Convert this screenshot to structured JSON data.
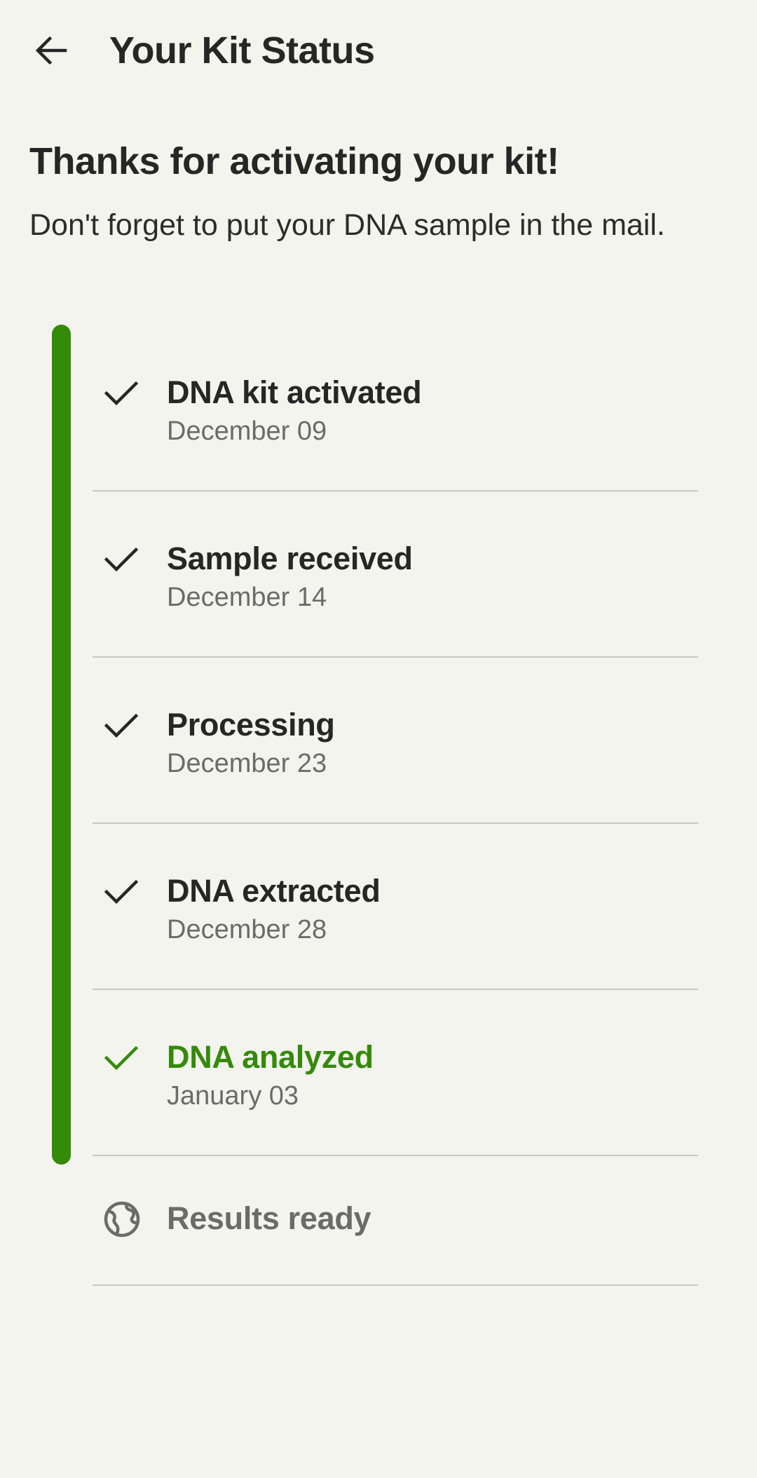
{
  "colors": {
    "background": "#f4f4ee",
    "accent_green": "#348a09",
    "text_primary": "#262626",
    "text_secondary": "#6b6b6b",
    "divider": "#c8c8c3"
  },
  "header": {
    "back_icon": "arrow-left-icon",
    "title": "Your Kit Status"
  },
  "main": {
    "heading": "Thanks for activating your kit!",
    "subtitle": "Don't forget to put your DNA sample in the mail."
  },
  "steps": [
    {
      "title": "DNA kit activated",
      "date": "December 09",
      "status": "complete",
      "icon": "check-icon"
    },
    {
      "title": "Sample received",
      "date": "December 14",
      "status": "complete",
      "icon": "check-icon"
    },
    {
      "title": "Processing",
      "date": "December 23",
      "status": "complete",
      "icon": "check-icon"
    },
    {
      "title": "DNA extracted",
      "date": "December 28",
      "status": "complete",
      "icon": "check-icon"
    },
    {
      "title": "DNA analyzed",
      "date": "January 03",
      "status": "current",
      "icon": "check-icon"
    },
    {
      "title": "Results ready",
      "date": "",
      "status": "pending",
      "icon": "globe-icon"
    }
  ]
}
